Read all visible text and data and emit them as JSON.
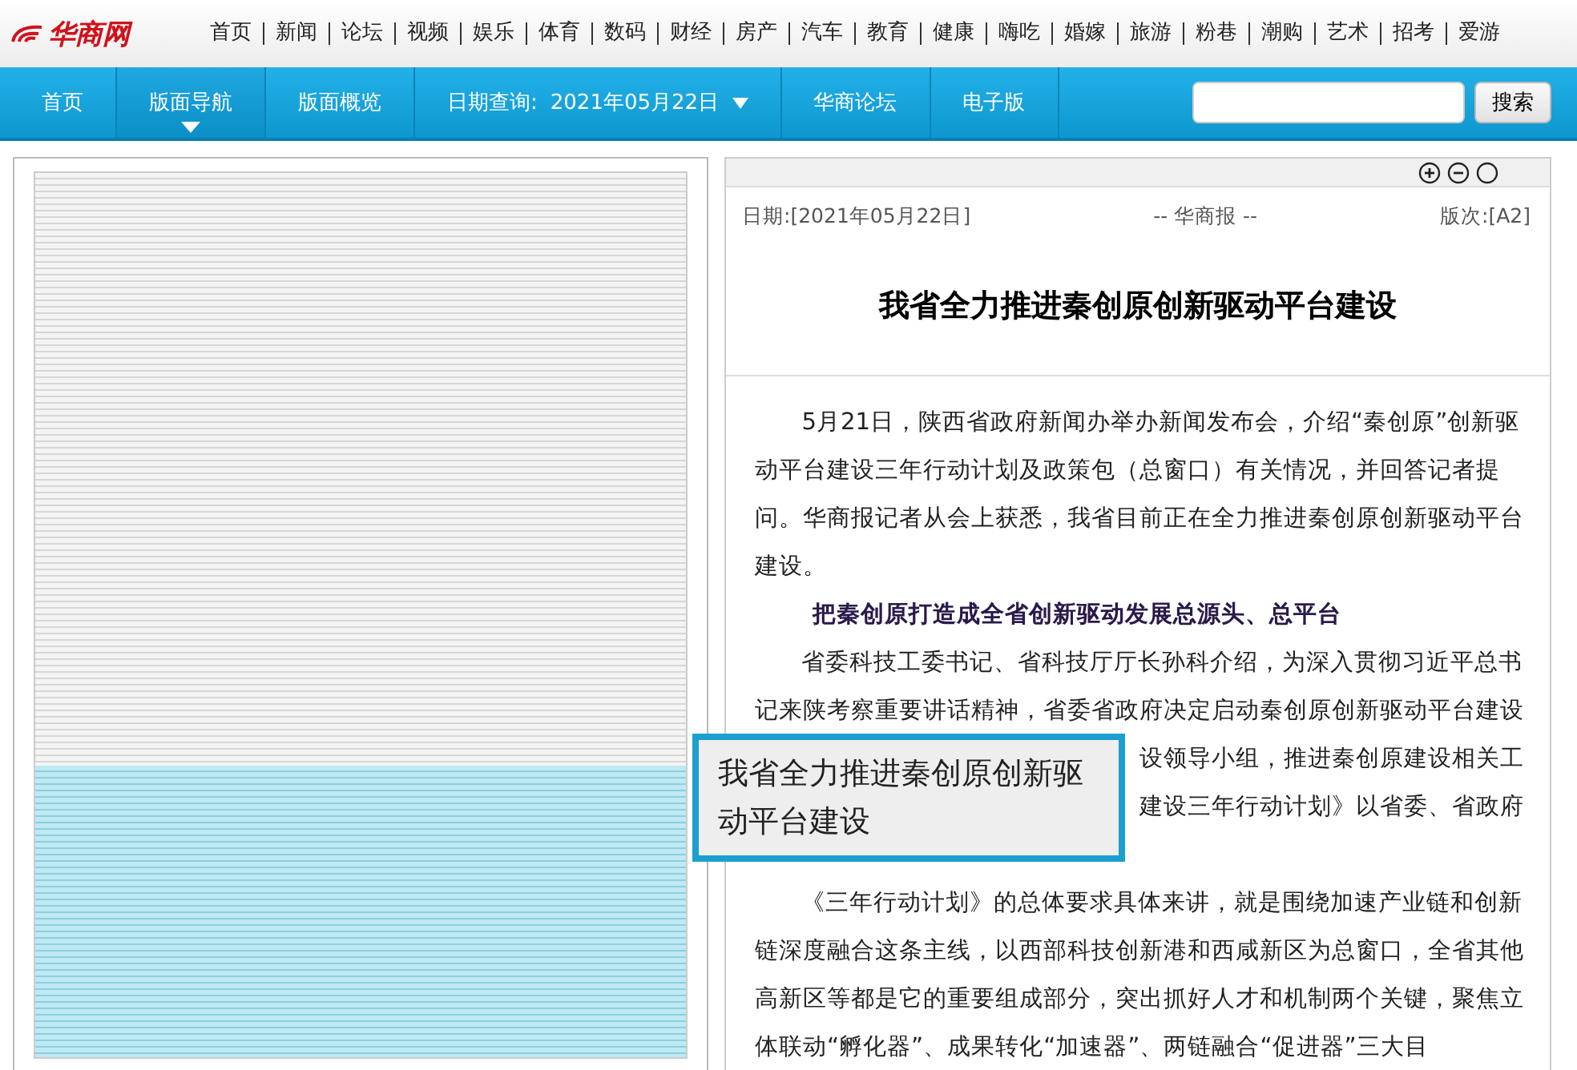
{
  "site": {
    "logo": "华商网",
    "top_menu": [
      "首页",
      "新闻",
      "论坛",
      "视频",
      "娱乐",
      "体育",
      "数码",
      "财经",
      "房产",
      "汽车",
      "教育",
      "健康",
      "嗨吃",
      "婚嫁",
      "旅游",
      "粉巷",
      "潮购",
      "艺术",
      "招考",
      "爱游"
    ]
  },
  "nav": {
    "items": [
      {
        "label": "首页",
        "selected": false,
        "kind": "link"
      },
      {
        "label": "版面导航",
        "selected": true,
        "kind": "link"
      },
      {
        "label": "版面概览",
        "selected": false,
        "kind": "link"
      },
      {
        "label": "日期查询:",
        "value": "2021年05月22日",
        "selected": false,
        "kind": "date"
      },
      {
        "label": "华商论坛",
        "selected": false,
        "kind": "link"
      },
      {
        "label": "电子版",
        "selected": false,
        "kind": "link"
      }
    ],
    "search_button": "搜索"
  },
  "article": {
    "date": "日期:[2021年05月22日]",
    "source": "-- 华商报 --",
    "edition": "版次:[A2]",
    "title": "我省全力推进秦创原创新驱动平台建设",
    "blocks": [
      {
        "kind": "para",
        "lines": [
          "5月21日，陕西省政府新闻办举办新闻发布会，介绍“秦创原”创新驱",
          "动平台建设三年行动计划及政策包（总窗口）有关情况，并回答记者提",
          "问。华商报记者从会上获悉，我省目前正在全力推进秦创原创新驱动平台",
          "建设。"
        ]
      },
      {
        "kind": "heading",
        "lines": [
          "把秦创原打造成全省创新驱动发展总源头、总平台"
        ]
      },
      {
        "kind": "para",
        "lines": [
          " 省委科技工委书记、省科技厅厅长孙科介绍，为深入贯彻习近平总书",
          "记来陕考察重要讲话精神，省委省政府决定启动秦创原创新驱动平台建设"
        ]
      },
      {
        "kind": "covered",
        "lines": [
          "设领导小组，推进秦创原建设相关工",
          "建设三年行动计划》以省委、省政府"
        ]
      },
      {
        "kind": "para",
        "lines": [
          "《三年行动计划》的总体要求具体来讲，就是围绕加速产业链和创新",
          "链深度融合这条主线，以西部科技创新港和西咸新区为总窗口，全省其他",
          "高新区等都是它的重要组成部分，突出抓好人才和机制两个关键，聚焦立",
          "体联动“孵化器”、成果转化“加速器”、两链融合“促进器”三大目"
        ]
      }
    ]
  },
  "tooltip": "我省全力推进秦创原创新驱动平台建设"
}
